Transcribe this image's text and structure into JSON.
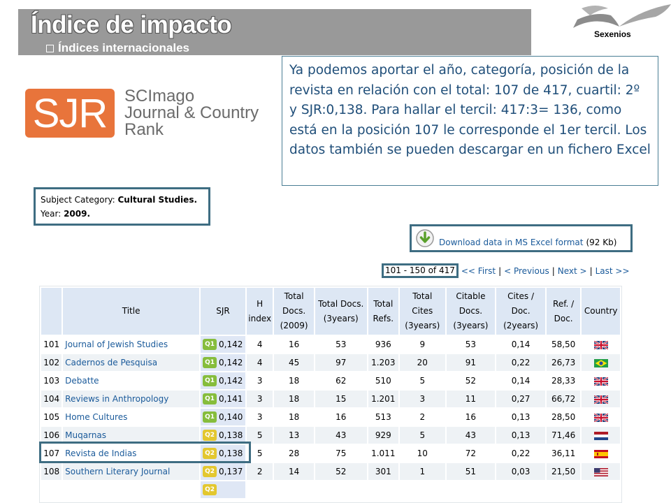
{
  "header": {
    "title": "Índice de impacto",
    "subtitle": "Índices internacionales",
    "logo_label": "Sexenios"
  },
  "sjr_logo": {
    "mark": "SJR",
    "line1": "SCImago",
    "line2": "Journal & Country",
    "line3": "Rank"
  },
  "callout": {
    "text": "Ya podemos aportar el año, categoría, posición de la revista en relación con el total: 107 de 417, cuartil: 2º y SJR:0,138. Para hallar el tercil: 417:3= 136, como está en la posición 107 le corresponde el 1er tercil. Los datos también se pueden descargar en un fichero Excel"
  },
  "subject": {
    "category_label": "Subject Category:",
    "category_value": "Cultural Studies.",
    "year_label": "Year:",
    "year_value": "2009."
  },
  "download": {
    "link": "Download data in MS Excel format",
    "size": "(92 Kb)"
  },
  "pagination": {
    "range": "101 - 150 of 417",
    "first": "<< First",
    "previous": "< Previous",
    "next": "Next >",
    "last": "Last >>",
    "separator": "|"
  },
  "table": {
    "headers": {
      "title": "Title",
      "sjr": "SJR",
      "h_index": "H index",
      "total_docs_year": "Total Docs. (2009)",
      "total_docs_3y": "Total Docs. (3years)",
      "total_refs": "Total Refs.",
      "total_cites": "Total Cites (3years)",
      "citable_docs": "Citable Docs. (3years)",
      "cites_doc": "Cites / Doc. (2years)",
      "ref_doc": "Ref. / Doc.",
      "country": "Country"
    },
    "rows": [
      {
        "rank": "101",
        "title": "Journal of Jewish Studies",
        "quartile": "Q1",
        "sjr": "0,142",
        "h": "4",
        "docs_year": "16",
        "docs_3y": "53",
        "refs": "936",
        "cites": "9",
        "citable": "53",
        "cites_doc": "0,14",
        "ref_doc": "58,50",
        "country": "uk-flag"
      },
      {
        "rank": "102",
        "title": "Cadernos de Pesquisa",
        "quartile": "Q1",
        "sjr": "0,142",
        "h": "4",
        "docs_year": "45",
        "docs_3y": "97",
        "refs": "1.203",
        "cites": "20",
        "citable": "91",
        "cites_doc": "0,22",
        "ref_doc": "26,73",
        "country": "brazil-flag"
      },
      {
        "rank": "103",
        "title": "Debatte",
        "quartile": "Q1",
        "sjr": "0,142",
        "h": "3",
        "docs_year": "18",
        "docs_3y": "62",
        "refs": "510",
        "cites": "5",
        "citable": "52",
        "cites_doc": "0,14",
        "ref_doc": "28,33",
        "country": "uk-flag"
      },
      {
        "rank": "104",
        "title": "Reviews in Anthropology",
        "quartile": "Q1",
        "sjr": "0,141",
        "h": "3",
        "docs_year": "18",
        "docs_3y": "15",
        "refs": "1.201",
        "cites": "3",
        "citable": "11",
        "cites_doc": "0,27",
        "ref_doc": "66,72",
        "country": "uk-flag"
      },
      {
        "rank": "105",
        "title": "Home Cultures",
        "quartile": "Q1",
        "sjr": "0,140",
        "h": "3",
        "docs_year": "18",
        "docs_3y": "16",
        "refs": "513",
        "cites": "2",
        "citable": "16",
        "cites_doc": "0,13",
        "ref_doc": "28,50",
        "country": "uk-flag"
      },
      {
        "rank": "106",
        "title": "Muqarnas",
        "quartile": "Q2",
        "sjr": "0,138",
        "h": "5",
        "docs_year": "13",
        "docs_3y": "43",
        "refs": "929",
        "cites": "5",
        "citable": "43",
        "cites_doc": "0,13",
        "ref_doc": "71,46",
        "country": "netherlands-flag"
      },
      {
        "rank": "107",
        "title": "Revista de Indias",
        "quartile": "Q2",
        "sjr": "0,138",
        "h": "5",
        "docs_year": "28",
        "docs_3y": "75",
        "refs": "1.011",
        "cites": "10",
        "citable": "72",
        "cites_doc": "0,22",
        "ref_doc": "36,11",
        "country": "spain-flag"
      },
      {
        "rank": "108",
        "title": "Southern Literary Journal",
        "quartile": "Q2",
        "sjr": "0,137",
        "h": "2",
        "docs_year": "14",
        "docs_3y": "52",
        "refs": "301",
        "cites": "1",
        "citable": "51",
        "cites_doc": "0,03",
        "ref_doc": "21,50",
        "country": "usa-flag"
      },
      {
        "rank": "",
        "title": "",
        "quartile": "Q2",
        "sjr": "",
        "h": "",
        "docs_year": "",
        "docs_3y": "",
        "refs": "",
        "cites": "",
        "citable": "",
        "cites_doc": "",
        "ref_doc": "",
        "country": ""
      }
    ]
  },
  "colors": {
    "accent": "#3e6d82",
    "link": "#1a5a9a",
    "sjr_orange": "#e8743b",
    "q1": "#86bd3c",
    "q2": "#e3c72f"
  }
}
